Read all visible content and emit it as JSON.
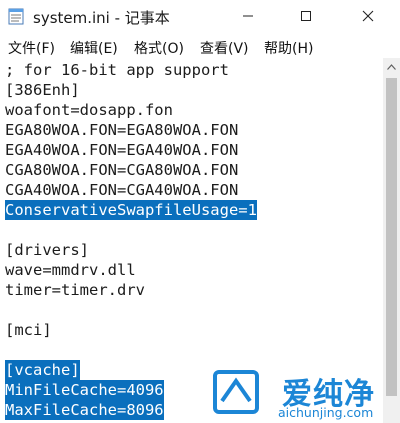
{
  "window": {
    "title": "system.ini - 记事本"
  },
  "menu": [
    "文件(F)",
    "编辑(E)",
    "格式(O)",
    "查看(V)",
    "帮助(H)"
  ],
  "editor": {
    "lines": [
      {
        "text": "; for 16-bit app support",
        "selected": false
      },
      {
        "text": "[386Enh]",
        "selected": false
      },
      {
        "text": "woafont=dosapp.fon",
        "selected": false
      },
      {
        "text": "EGA80WOA.FON=EGA80WOA.FON",
        "selected": false
      },
      {
        "text": "EGA40WOA.FON=EGA40WOA.FON",
        "selected": false
      },
      {
        "text": "CGA80WOA.FON=CGA80WOA.FON",
        "selected": false
      },
      {
        "text": "CGA40WOA.FON=CGA40WOA.FON",
        "selected": false
      },
      {
        "text": "ConservativeSwapfileUsage=1",
        "selected": true
      },
      {
        "text": "",
        "selected": false
      },
      {
        "text": "[drivers]",
        "selected": false
      },
      {
        "text": "wave=mmdrv.dll",
        "selected": false
      },
      {
        "text": "timer=timer.drv",
        "selected": false
      },
      {
        "text": "",
        "selected": false
      },
      {
        "text": "[mci]",
        "selected": false
      },
      {
        "text": "",
        "selected": false
      },
      {
        "text": "[vcache]",
        "selected": true
      },
      {
        "text": "MinFileCache=4096",
        "selected": true
      },
      {
        "text": "MaxFileCache=8096",
        "selected": true
      }
    ]
  },
  "watermark": {
    "title": "爱纯净",
    "url": "aichunjing.com"
  },
  "colors": {
    "selection": "#0a6fbd",
    "watermark": "#1c86d6"
  }
}
